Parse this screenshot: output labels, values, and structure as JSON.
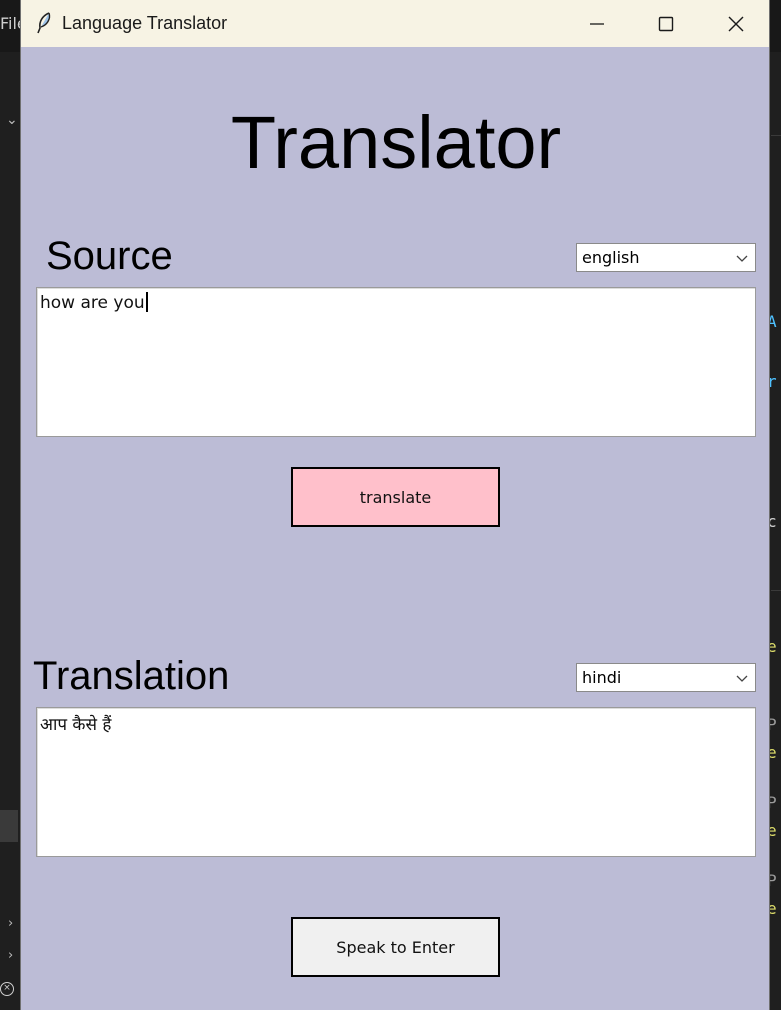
{
  "background": {
    "menu_fragment": "File"
  },
  "window": {
    "title": "Language Translator",
    "minimize_icon": "minimize-icon",
    "maximize_icon": "maximize-icon",
    "close_icon": "close-icon",
    "app_icon": "feather-icon"
  },
  "app": {
    "heading": "Translator",
    "source": {
      "label": "Source",
      "language": "english",
      "text": "how are you"
    },
    "translate_button": "translate",
    "translation": {
      "label": "Translation",
      "language": "hindi",
      "text": "आप कैसे हैं"
    },
    "speak_button": "Speak to Enter"
  },
  "colors": {
    "window_bg": "#bcbcd6",
    "translate_button_bg": "#ffc0cb",
    "speak_button_bg": "#f0f0f0",
    "titlebar_bg": "#f7f3e4"
  }
}
